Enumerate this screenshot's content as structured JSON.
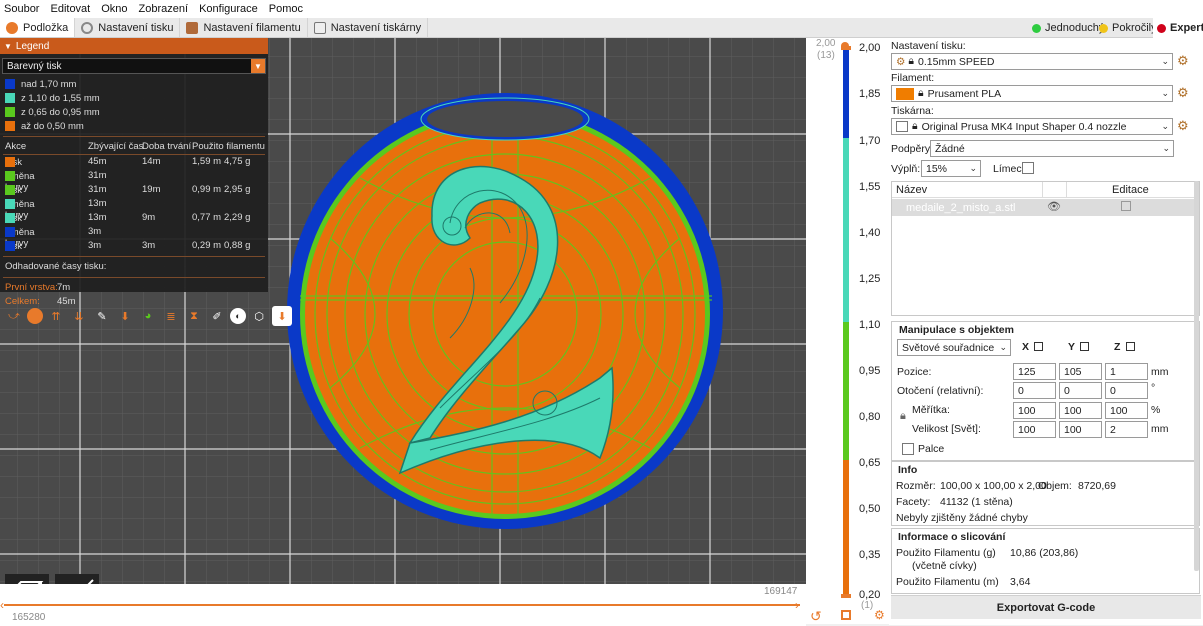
{
  "menu": [
    "Soubor",
    "Editovat",
    "Okno",
    "Zobrazení",
    "Konfigurace",
    "Pomoc"
  ],
  "tabs": [
    {
      "label": "Podložka",
      "active": true
    },
    {
      "label": "Nastavení tisku"
    },
    {
      "label": "Nastavení filamentu"
    },
    {
      "label": "Nastavení tiskárny"
    }
  ],
  "modes": [
    {
      "label": "Jednoduchý",
      "color": "#2ecc40"
    },
    {
      "label": "Pokročilý",
      "color": "#f0c419"
    },
    {
      "label": "Expert",
      "color": "#d0021b"
    }
  ],
  "legend": {
    "title": "Legend",
    "view_type": "Barevný tisk",
    "ranges": [
      {
        "label": "nad 1,70 mm",
        "color": "#0a39c8"
      },
      {
        "label": "z 1,10 do 1,55 mm",
        "color": "#49d8b8"
      },
      {
        "label": "z 0,65 do 0,95 mm",
        "color": "#5ac91e"
      },
      {
        "label": "až do 0,50 mm",
        "color": "#e8700c"
      }
    ],
    "headers": {
      "action": "Akce",
      "remaining": "Zbývající čas",
      "duration": "Doba trvání",
      "used": "Použito filamentu"
    },
    "rows": [
      {
        "action": "Tisk",
        "remaining": "45m",
        "duration": "14m",
        "length": "1,59 m",
        "weight": "4,75 g"
      },
      {
        "action": "Změna barvy",
        "remaining": "31m"
      },
      {
        "action": "Tisk",
        "remaining": "31m",
        "duration": "19m",
        "length": "0,99 m",
        "weight": "2,95 g"
      },
      {
        "action": "Změna barvy",
        "remaining": "13m"
      },
      {
        "action": "Tisk",
        "remaining": "13m",
        "duration": "9m",
        "length": "0,77 m",
        "weight": "2,29 g"
      },
      {
        "action": "Změna barvy",
        "remaining": "3m"
      },
      {
        "action": "Tisk",
        "remaining": "3m",
        "duration": "3m",
        "length": "0,29 m",
        "weight": "0,88 g"
      }
    ],
    "estimated_title": "Odhadované časy tisku:",
    "first_layer_label": "První vrstva:",
    "first_layer_value": "7m",
    "total_label": "Celkem:",
    "total_value": "45m"
  },
  "viewport": {
    "scale_left": "165280",
    "scale_right": "169147"
  },
  "layer_slider": {
    "top_value": "2,00",
    "top_layer": "(13)",
    "ticks": [
      "2,00",
      "1,85",
      "1,70",
      "1,55",
      "1,40",
      "1,25",
      "1,10",
      "0,95",
      "0,80",
      "0,65",
      "0,50",
      "0,35",
      "0,20"
    ],
    "bottom_layer": "(1)"
  },
  "right_panel": {
    "print_settings_label": "Nastavení tisku:",
    "print_settings_value": "0.15mm SPEED",
    "filament_label": "Filament:",
    "filament_value": "Prusament PLA",
    "filament_color": "#f07d00",
    "printer_label": "Tiskárna:",
    "printer_value": "Original Prusa MK4 Input Shaper 0.4 nozzle",
    "supports_label": "Podpěry:",
    "supports_value": "Žádné",
    "infill_label": "Výplň:",
    "infill_value": "15%",
    "brim_label": "Límec:",
    "objects_col_name": "Název",
    "objects_col_edit": "Editace",
    "object_name": "medaile_2_misto_a.stl",
    "manipulation_title": "Manipulace s objektem",
    "coords_value": "Světové souřadnice",
    "x_label": "X",
    "y_label": "Y",
    "z_label": "Z",
    "position_label": "Pozice:",
    "position": [
      "125",
      "105",
      "1"
    ],
    "rotation_label": "Otočení (relativní):",
    "rotation": [
      "0",
      "0",
      "0"
    ],
    "scale_label": "Měřítka:",
    "scale": [
      "100",
      "100",
      "100"
    ],
    "size_label": "Velikost [Svět]:",
    "size": [
      "100",
      "100",
      "2"
    ],
    "unit_mm": "mm",
    "unit_deg": "°",
    "unit_pct": "%",
    "inches_label": "Palce",
    "info_title": "Info",
    "size_info_label": "Rozměr:",
    "size_info_value": "100,00 x 100,00 x 2,00",
    "volume_label": "Objem:",
    "volume_value": "8720,69",
    "facets_label": "Facety:",
    "facets_value": "41132 (1 stěna)",
    "errors_text": "Nebyly zjištěny žádné chyby",
    "slice_title": "Informace o slicování",
    "used_g_label": "Použito Filamentu (g)",
    "used_g_sub": "(včetně cívky)",
    "used_g_value": "10,86 (203,86)",
    "used_m_label": "Použito Filamentu (m)",
    "used_m_value": "3,64",
    "export_label": "Exportovat G-code"
  }
}
